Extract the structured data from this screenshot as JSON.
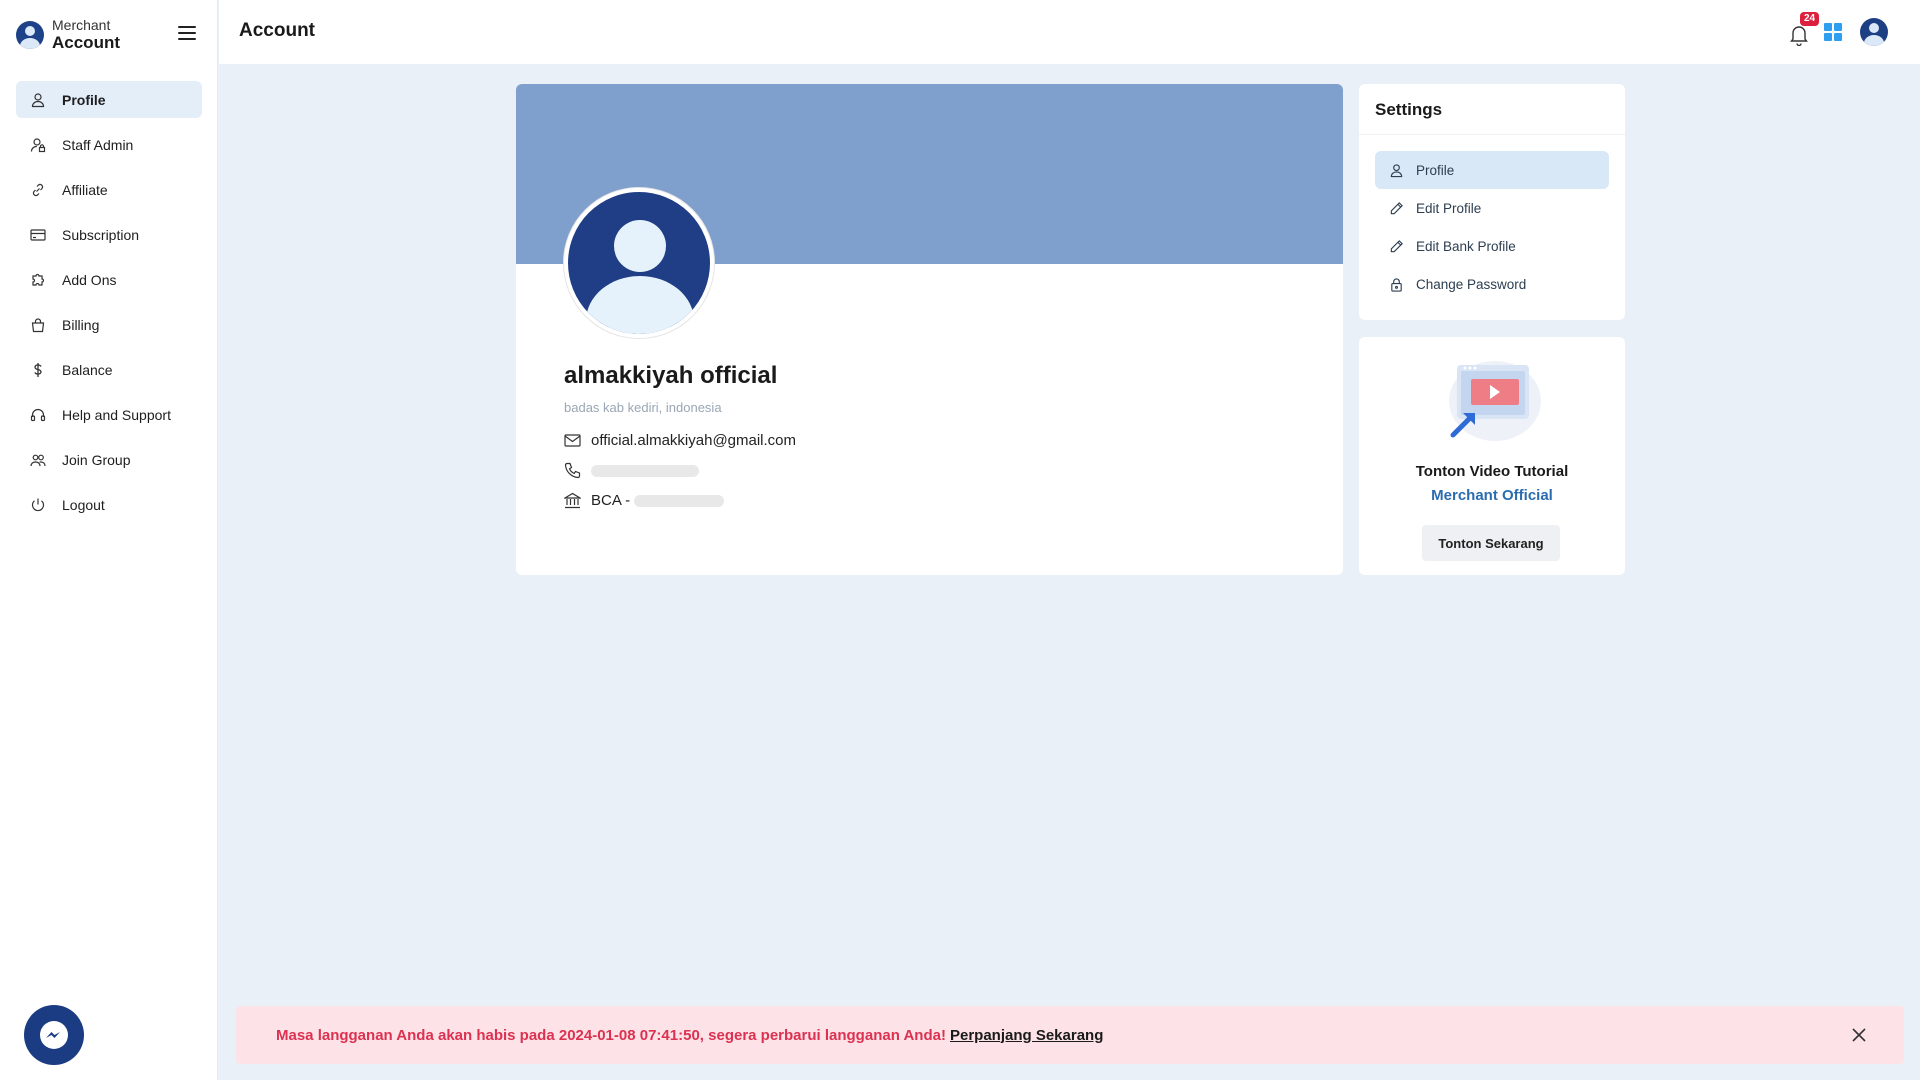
{
  "brand": {
    "top": "Merchant",
    "bottom": "Account"
  },
  "sidebar": {
    "items": [
      {
        "label": "Profile",
        "icon": "user-icon",
        "active": true
      },
      {
        "label": "Staff Admin",
        "icon": "user-lock-icon"
      },
      {
        "label": "Affiliate",
        "icon": "link-icon"
      },
      {
        "label": "Subscription",
        "icon": "credit-card-icon"
      },
      {
        "label": "Add Ons",
        "icon": "puzzle-icon"
      },
      {
        "label": "Billing",
        "icon": "shopping-bag-icon"
      },
      {
        "label": "Balance",
        "icon": "dollar-icon"
      },
      {
        "label": "Help and Support",
        "icon": "headset-icon"
      },
      {
        "label": "Join Group",
        "icon": "group-icon"
      },
      {
        "label": "Logout",
        "icon": "power-icon"
      }
    ]
  },
  "header": {
    "title": "Account",
    "notification_count": "24"
  },
  "profile": {
    "name": "almakkiyah official",
    "location": "badas kab kediri, indonesia",
    "email": "official.almakkiyah@gmail.com",
    "bank_prefix": "BCA -"
  },
  "settings": {
    "title": "Settings",
    "items": [
      {
        "label": "Profile",
        "icon": "user-icon",
        "active": true
      },
      {
        "label": "Edit Profile",
        "icon": "pencil-icon"
      },
      {
        "label": "Edit Bank Profile",
        "icon": "pencil-icon"
      },
      {
        "label": "Change Password",
        "icon": "lock-icon"
      }
    ]
  },
  "tutorial": {
    "title": "Tonton Video Tutorial",
    "subtitle": "Merchant Official",
    "button": "Tonton Sekarang"
  },
  "alert": {
    "message": "Masa langganan Anda akan habis pada 2024-01-08 07:41:50, segera perbarui langganan Anda!",
    "link": "Perpanjang Sekarang"
  },
  "colors": {
    "primary": "#1d3f84",
    "cover": "#7f9fcd",
    "alert_bg": "#fde3e8",
    "alert_text": "#dc3150",
    "badge": "#dc1f3d",
    "link": "#2b6cb0"
  }
}
